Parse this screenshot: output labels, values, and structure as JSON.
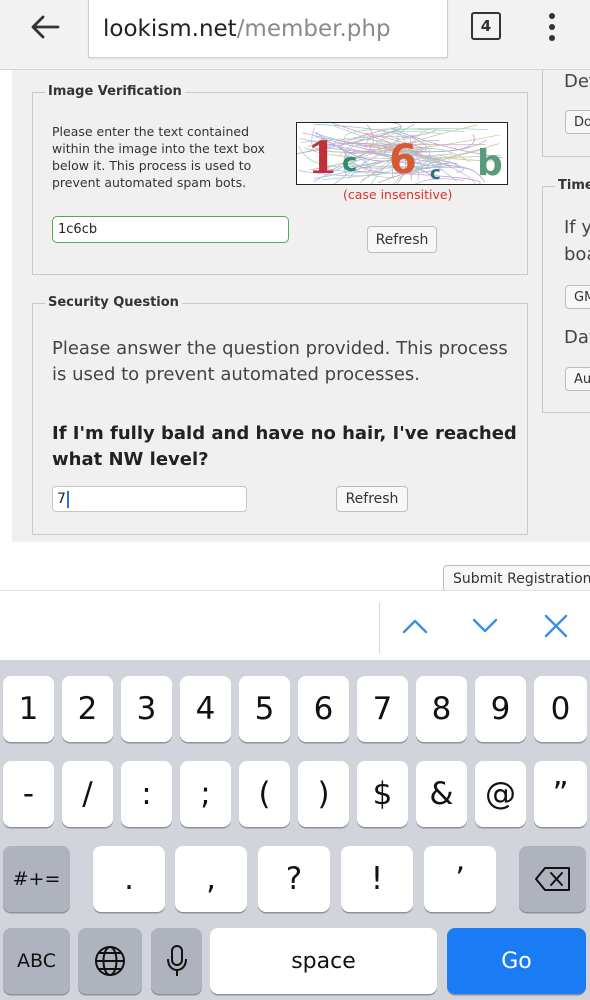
{
  "browser": {
    "url_host": "lookism.net",
    "url_path": "/member.php",
    "tab_count": "4"
  },
  "image_verification": {
    "legend": "Image Verification",
    "instructions": "Please enter the text contained within the image into the text box below it. This process is used to prevent automated spam bots.",
    "captcha_text": "1c6cb",
    "case_note": "(case insensitive)",
    "input_value": "1c6cb",
    "refresh_label": "Refresh"
  },
  "security_question": {
    "legend": "Security Question",
    "instructions": "Please answer the question provided. This process is used to prevent automated processes.",
    "question": "If I'm fully bald and have no hair, I've reached what NW level?",
    "answer_value": "7",
    "refresh_label": "Refresh"
  },
  "right_column": {
    "default_label": "Defa",
    "default_button": "Do n",
    "timezone_legend": "Time Z",
    "timezone_text_1": "If yo",
    "timezone_text_2": "boar",
    "timezone_button": "GMT",
    "daylight_label": "Dayl",
    "daylight_button": "Auto"
  },
  "submit_label": "Submit Registration",
  "keyboard": {
    "row1": [
      "1",
      "2",
      "3",
      "4",
      "5",
      "6",
      "7",
      "8",
      "9",
      "0"
    ],
    "row2": [
      "-",
      "/",
      ":",
      ";",
      "(",
      ")",
      "$",
      "&",
      "@",
      "”"
    ],
    "row3": [
      ".",
      ",",
      "?",
      "!",
      "’"
    ],
    "symbols_label": "#+=",
    "abc_label": "ABC",
    "space_label": "space",
    "go_label": "Go"
  },
  "colors": {
    "go_key": "#1a7cf5",
    "accessory_icons": "#3d8fe0",
    "captcha_note": "#e0302a",
    "input_focus_border": "#4caf50"
  }
}
